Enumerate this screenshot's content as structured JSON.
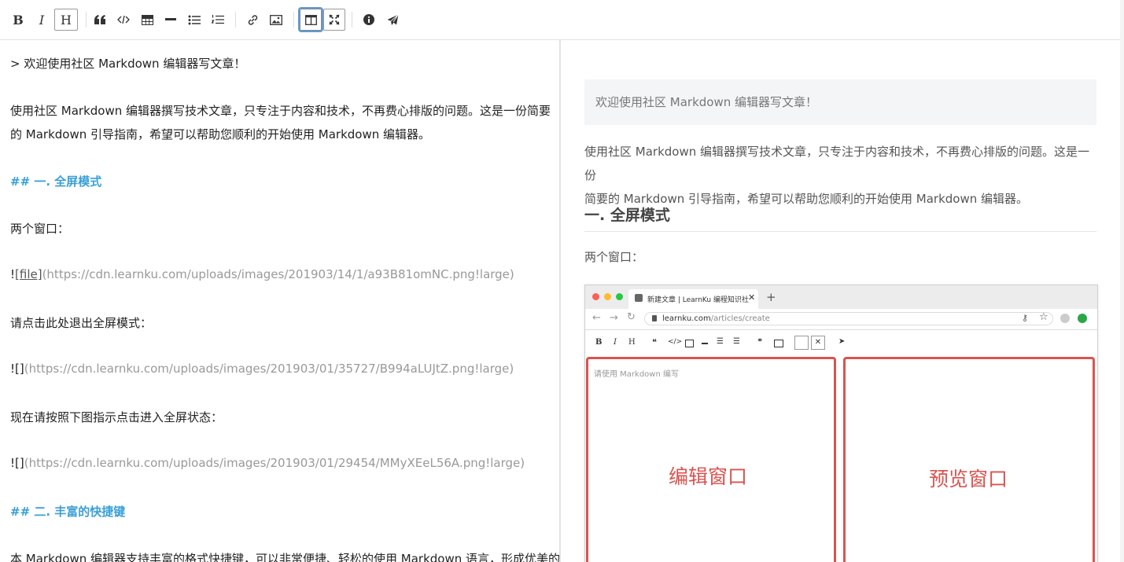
{
  "toolbar": {
    "bold_label": "B",
    "italic_label": "I",
    "heading_label": "H"
  },
  "editor": {
    "lines": [
      "> 欢迎使用社区 Markdown 编辑器写文章！",
      "使用社区 Markdown 编辑器撰写技术文章，只专注于内容和技术，不再费心排版的问题。这是一份简要",
      "的 Markdown 引导指南，希望可以帮助您顺利的开始使用 Markdown 编辑器。",
      "## 一. 全屏模式",
      "两个窗口：",
      "请点击此处退出全屏模式：",
      "现在请按照下图指示点击进入全屏状态：",
      "## 二. 丰富的快捷键",
      "本 Markdown 编辑器支持丰富的格式快捷键，可以非常便捷、轻松的使用 Markdown 语言，形成优美的"
    ],
    "img1_prefix": "!",
    "img1_alt": "[file]",
    "img1_url": "(https://cdn.learnku.com/uploads/images/201903/14/1/a93B81omNC.png!large)",
    "img2_prefix": "![]",
    "img2_url": "(https://cdn.learnku.com/uploads/images/201903/01/35727/B994aLUJtZ.png!large)",
    "img3_prefix": "![]",
    "img3_url": "(https://cdn.learnku.com/uploads/images/201903/01/29454/MMyXEeL56A.png!large)"
  },
  "preview": {
    "quote": "欢迎使用社区 Markdown 编辑器写文章！",
    "para1_line1": "使用社区 Markdown 编辑器撰写技术文章，只专注于内容和技术，不再费心排版的问题。这是一份",
    "para1_line2": "简要的 Markdown 引导指南，希望可以帮助您顺利的开始使用 Markdown 编辑器。",
    "heading": "一. 全屏模式",
    "para2": "两个窗口：",
    "screenshot": {
      "tab_title": "新建文章 | LearnKu 编程知识社",
      "url_host": "learnku.com",
      "url_path": "/articles/create",
      "toolbar_b": "B",
      "toolbar_i": "I",
      "toolbar_h": "H",
      "editor_placeholder": "请使用 Markdown 编写",
      "left_label": "编辑窗口",
      "right_label": "预览窗口"
    }
  },
  "colors": {
    "heading_link": "#3aa0d5",
    "highlight": "#d9534f",
    "active_outline": "#5b9bdc"
  }
}
